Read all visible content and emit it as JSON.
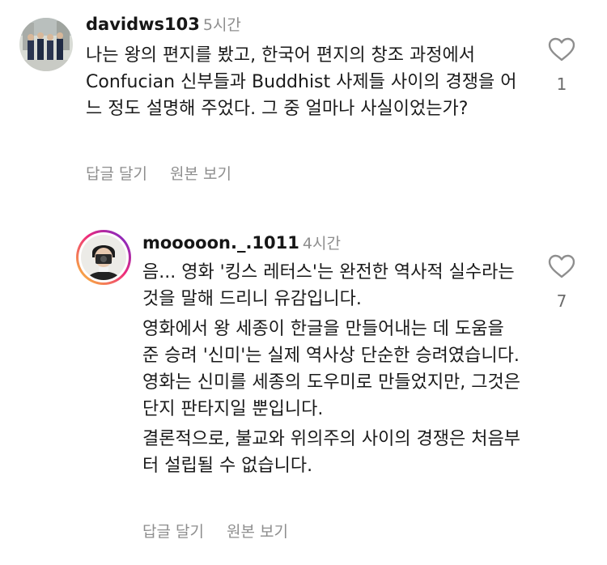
{
  "comments": [
    {
      "username": "davidws103",
      "time": "5시간",
      "text": [
        "나는 왕의 편지를 봤고, 한국어 편지의 창조 과정에서 Confucian 신부들과 Buddhist 사제들 사이의 경쟁을 어느 정도 설명해 주었다. 그 중 얼마나 사실이었는가?"
      ],
      "reply_label": "답글 달기",
      "translation_label": "원본 보기",
      "like_count": "1"
    },
    {
      "username": "mooooon._.1011",
      "time": "4시간",
      "text": [
        "음... 영화 '킹스 레터스'는 완전한 역사적 실수라는 것을 말해 드리니 유감입니다.",
        "영화에서 왕 세종이 한글을 만들어내는 데 도움을 준 승려 '신미'는 실제 역사상 단순한 승려였습니다. 영화는 신미를 세종의 도우미로 만들었지만, 그것은 단지 판타지일 뿐입니다.",
        "결론적으로, 불교와 위의주의 사이의 경쟁은 처음부터 설립될 수 없습니다."
      ],
      "reply_label": "답글 달기",
      "translation_label": "원본 보기",
      "like_count": "7"
    }
  ],
  "icons": {
    "like": "heart-outline-icon"
  },
  "colors": {
    "secondary_text": "#8e8e8e",
    "story_ring_start": "#f9ce34",
    "story_ring_mid": "#ee2a7b",
    "story_ring_end": "#6228d7"
  }
}
